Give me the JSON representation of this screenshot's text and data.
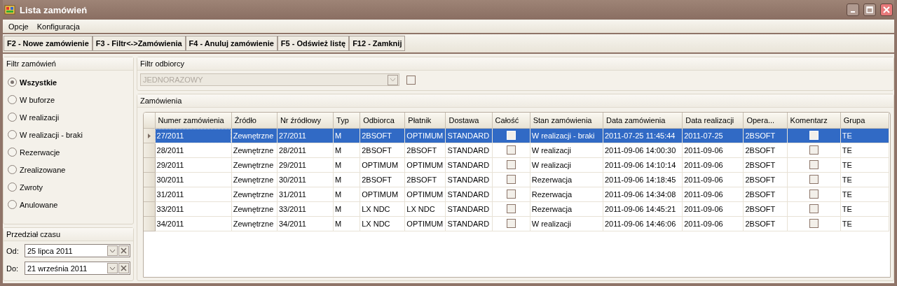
{
  "window": {
    "title": "Lista zamówień"
  },
  "menu": [
    "Opcje",
    "Konfiguracja"
  ],
  "toolbar": [
    "F2 - Nowe zamówienie",
    "F3 - Filtr<->Zamówienia",
    "F4 - Anuluj zamówienie",
    "F5 - Odśwież listę",
    "F12 - Zamknij"
  ],
  "order_filter": {
    "title": "Filtr zamówień",
    "options": [
      {
        "label": "Wszystkie",
        "selected": true
      },
      {
        "label": "W buforze",
        "selected": false
      },
      {
        "label": "W realizacji",
        "selected": false
      },
      {
        "label": "W realizacji - braki",
        "selected": false
      },
      {
        "label": "Rezerwacje",
        "selected": false
      },
      {
        "label": "Zrealizowane",
        "selected": false
      },
      {
        "label": "Zwroty",
        "selected": false
      },
      {
        "label": "Anulowane",
        "selected": false
      }
    ]
  },
  "time_range": {
    "title": "Przedział czasu",
    "fields": [
      {
        "label": "Od:",
        "value": "25 lipca 2011"
      },
      {
        "label": "Do:",
        "value": "21 września 2011"
      }
    ]
  },
  "customer_filter": {
    "title": "Filtr odbiorcy",
    "value": "JEDNORAZOWY",
    "disabled": true,
    "checked": false
  },
  "orders": {
    "title": "Zamówienia",
    "columns": [
      "Numer zamówienia",
      "Źródło",
      "Nr źródłowy",
      "Typ",
      "Odbiorca",
      "Płatnik",
      "Dostawa",
      "Całość",
      "Stan zamówienia",
      "Data zamówienia",
      "Data realizacji",
      "Opera...",
      "Komentarz",
      "Grupa"
    ],
    "rows": [
      {
        "selected": true,
        "cells": [
          "27/2011",
          "Zewnętrzne",
          "27/2011",
          "M",
          "2BSOFT",
          "OPTIMUM",
          "STANDARD",
          false,
          "W realizacji - braki",
          "2011-07-25 11:45:44",
          "2011-07-25",
          "2BSOFT",
          false,
          "TE"
        ]
      },
      {
        "selected": false,
        "cells": [
          "28/2011",
          "Zewnętrzne",
          "28/2011",
          "M",
          "2BSOFT",
          "2BSOFT",
          "STANDARD",
          false,
          "W realizacji",
          "2011-09-06 14:00:30",
          "2011-09-06",
          "2BSOFT",
          false,
          "TE"
        ]
      },
      {
        "selected": false,
        "cells": [
          "29/2011",
          "Zewnętrzne",
          "29/2011",
          "M",
          "OPTIMUM",
          "OPTIMUM",
          "STANDARD",
          false,
          "W realizacji",
          "2011-09-06 14:10:14",
          "2011-09-06",
          "2BSOFT",
          false,
          "TE"
        ]
      },
      {
        "selected": false,
        "cells": [
          "30/2011",
          "Zewnętrzne",
          "30/2011",
          "M",
          "2BSOFT",
          "2BSOFT",
          "STANDARD",
          false,
          "Rezerwacja",
          "2011-09-06 14:18:45",
          "2011-09-06",
          "2BSOFT",
          false,
          "TE"
        ]
      },
      {
        "selected": false,
        "cells": [
          "31/2011",
          "Zewnętrzne",
          "31/2011",
          "M",
          "OPTIMUM",
          "OPTIMUM",
          "STANDARD",
          false,
          "Rezerwacja",
          "2011-09-06 14:34:08",
          "2011-09-06",
          "2BSOFT",
          false,
          "TE"
        ]
      },
      {
        "selected": false,
        "cells": [
          "33/2011",
          "Zewnętrzne",
          "33/2011",
          "M",
          "LX NDC",
          "LX NDC",
          "STANDARD",
          false,
          "Rezerwacja",
          "2011-09-06 14:45:21",
          "2011-09-06",
          "2BSOFT",
          false,
          "TE"
        ]
      },
      {
        "selected": false,
        "cells": [
          "34/2011",
          "Zewnętrzne",
          "34/2011",
          "M",
          "LX NDC",
          "OPTIMUM",
          "STANDARD",
          false,
          "W realizacji",
          "2011-09-06 14:46:06",
          "2011-09-06",
          "2BSOFT",
          false,
          "TE"
        ]
      }
    ]
  }
}
